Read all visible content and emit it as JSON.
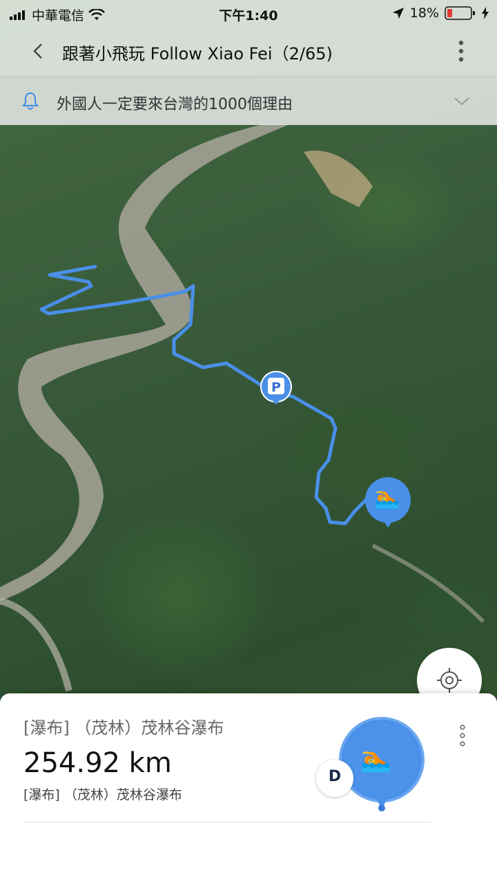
{
  "status_bar": {
    "carrier": "中華電信",
    "time": "下午1:40",
    "battery": "18%"
  },
  "header": {
    "title": "跟著小飛玩 Follow Xiao Fei（2/65)"
  },
  "banner": {
    "text": "外國人一定要來台灣的1000個理由"
  },
  "map": {
    "parking_label": "P"
  },
  "detail": {
    "category_title": "[瀑布] （茂林）茂林谷瀑布",
    "distance": "254.92 km",
    "subtitle": "[瀑布] （茂林）茂林谷瀑布",
    "badge_text": "D",
    "pin_emoji": "🏊"
  },
  "colors": {
    "route": "#4a8fe8",
    "accent": "#3a8ee6"
  }
}
